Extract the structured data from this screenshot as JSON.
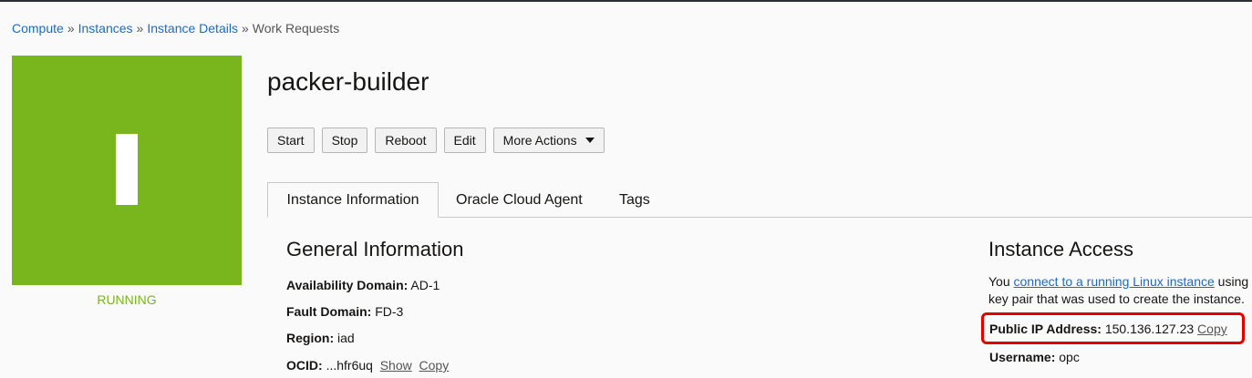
{
  "breadcrumb": {
    "items": [
      "Compute",
      "Instances",
      "Instance Details"
    ],
    "current": "Work Requests",
    "separator": "»"
  },
  "instance": {
    "icon_letter": "I",
    "status": "RUNNING",
    "name": "packer-builder",
    "status_color": "#79b51c"
  },
  "actions": {
    "start": "Start",
    "stop": "Stop",
    "reboot": "Reboot",
    "edit": "Edit",
    "more": "More Actions"
  },
  "tabs": [
    "Instance Information",
    "Oracle Cloud Agent",
    "Tags"
  ],
  "general": {
    "heading": "General Information",
    "availability_domain_label": "Availability Domain:",
    "availability_domain": "AD-1",
    "fault_domain_label": "Fault Domain:",
    "fault_domain": "FD-3",
    "region_label": "Region:",
    "region": "iad",
    "ocid_label": "OCID:",
    "ocid": "...hfr6uq",
    "show": "Show",
    "copy": "Copy"
  },
  "access": {
    "heading": "Instance Access",
    "text_before": "You ",
    "link": "connect to a running Linux instance",
    "text_after": " using key pair that was used to create the instance.",
    "public_ip_label": "Public IP Address:",
    "public_ip": "150.136.127.23",
    "copy": "Copy",
    "username_label": "Username:",
    "username": "opc"
  },
  "colors": {
    "accent_green": "#79b51c",
    "link_blue": "#1b6ac9",
    "highlight_red": "#e60000"
  }
}
